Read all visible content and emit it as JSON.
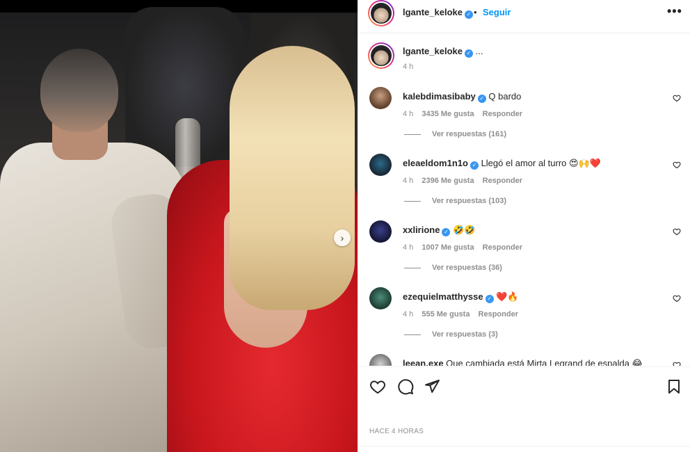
{
  "post": {
    "username": "lgante_keloke",
    "follow_label": "Seguir",
    "separator": "•",
    "more_label": "•••",
    "caption_username": "lgante_keloke",
    "caption_text": "...",
    "caption_time": "4 h",
    "time_ago": "HACE 4 HORAS"
  },
  "comments": [
    {
      "username": "kalebdimasibaby",
      "verified": true,
      "text": "Q bardo",
      "time": "4 h",
      "likes": "3435 Me gusta",
      "reply_label": "Responder",
      "view_replies": "Ver respuestas (161)"
    },
    {
      "username": "eleaeldom1n1o",
      "verified": true,
      "text": "Llegó el amor al turro 😍🙌❤️",
      "time": "4 h",
      "likes": "2396 Me gusta",
      "reply_label": "Responder",
      "view_replies": "Ver respuestas (103)"
    },
    {
      "username": "xxlirione",
      "verified": true,
      "text": "🤣🤣",
      "time": "4 h",
      "likes": "1007 Me gusta",
      "reply_label": "Responder",
      "view_replies": "Ver respuestas (36)"
    },
    {
      "username": "ezequielmatthysse",
      "verified": true,
      "text": "❤️🔥",
      "time": "4 h",
      "likes": "555 Me gusta",
      "reply_label": "Responder",
      "view_replies": "Ver respuestas (3)"
    },
    {
      "username": "leean.exe",
      "verified": false,
      "text": "Que cambiada está Mirta Legrand de espalda 😂",
      "time": "",
      "likes": "",
      "reply_label": "",
      "view_replies": ""
    }
  ],
  "icons": {
    "heart": "heart-icon",
    "comment": "comment-icon",
    "share": "share-icon",
    "save": "bookmark-icon",
    "verified": "verified-badge-icon",
    "next": "chevron-right-icon"
  },
  "colors": {
    "accent": "#0095f6",
    "verified": "#3897f0",
    "muted": "#8e8e8e",
    "text": "#262626"
  },
  "glyphs": {
    "next": "›",
    "verified": "✓",
    "small_heart": "♡"
  }
}
